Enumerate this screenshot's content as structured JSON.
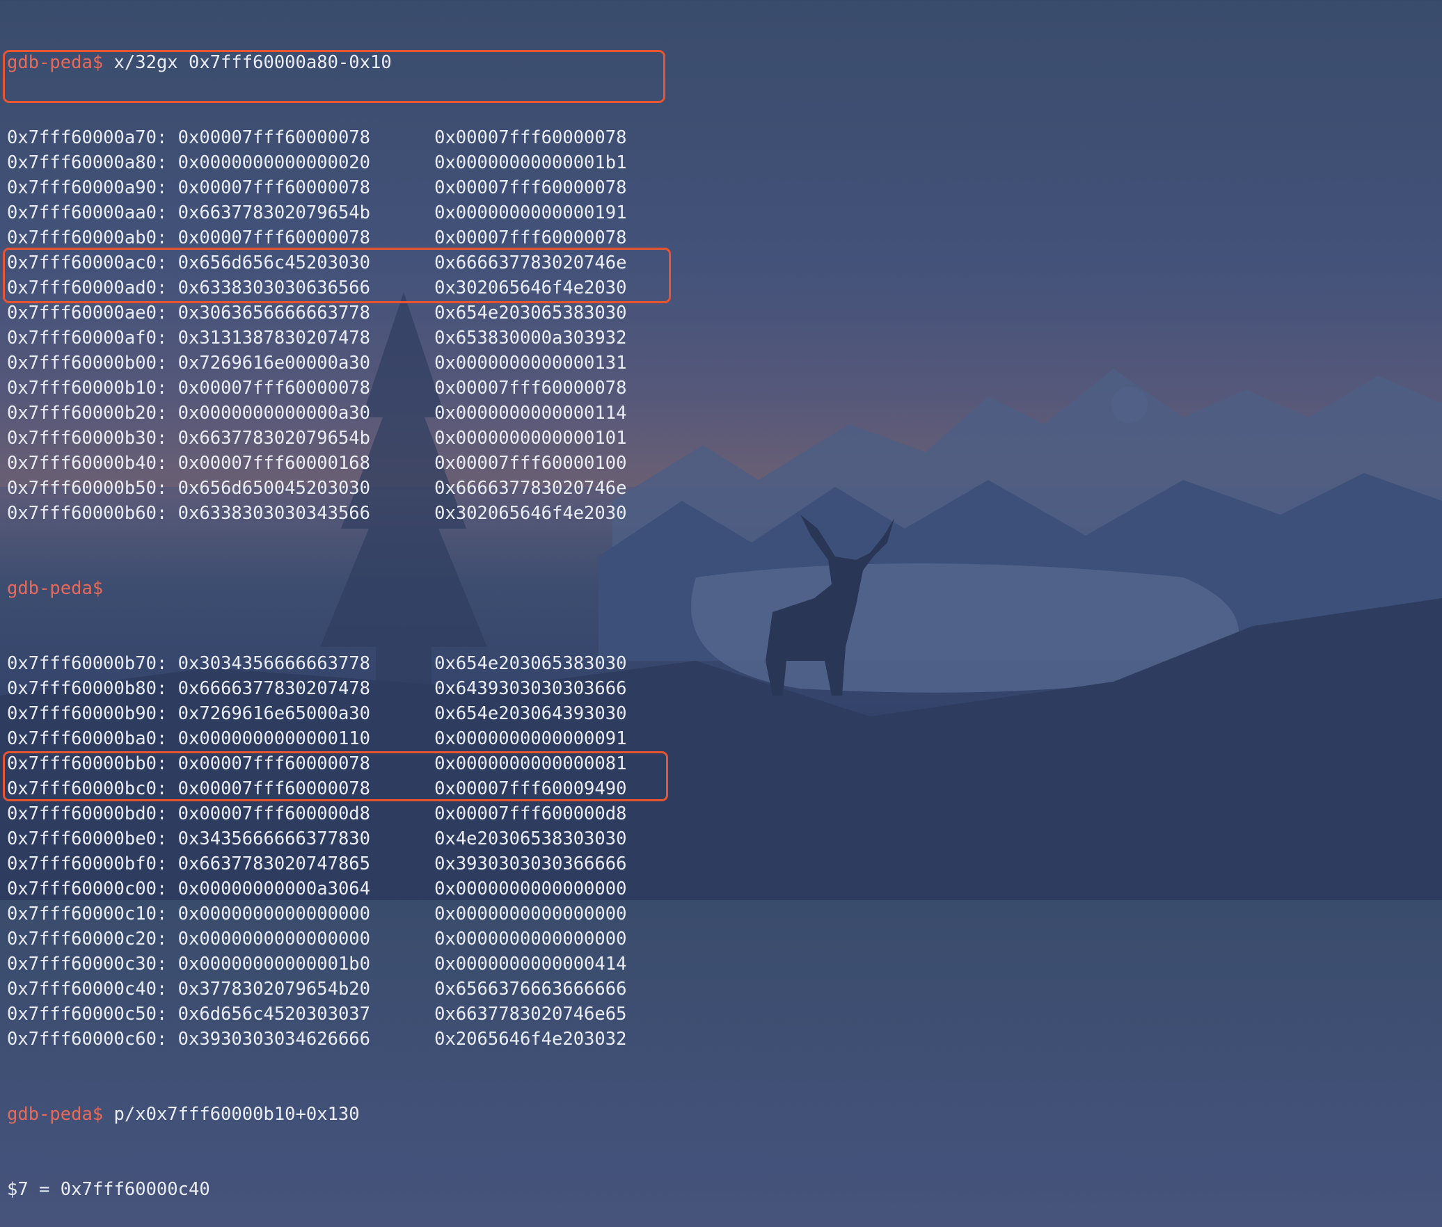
{
  "prompt": "gdb-peda$",
  "command_1": "x/32gx 0x7fff60000a80-0x10",
  "dump_1": [
    {
      "addr": "0x7fff60000a70:",
      "v1": "0x00007fff60000078",
      "v2": "0x00007fff60000078"
    },
    {
      "addr": "0x7fff60000a80:",
      "v1": "0x0000000000000020",
      "v2": "0x00000000000001b1"
    },
    {
      "addr": "0x7fff60000a90:",
      "v1": "0x00007fff60000078",
      "v2": "0x00007fff60000078"
    },
    {
      "addr": "0x7fff60000aa0:",
      "v1": "0x663778302079654b",
      "v2": "0x0000000000000191"
    },
    {
      "addr": "0x7fff60000ab0:",
      "v1": "0x00007fff60000078",
      "v2": "0x00007fff60000078"
    },
    {
      "addr": "0x7fff60000ac0:",
      "v1": "0x656d656c45203030",
      "v2": "0x666637783020746e"
    },
    {
      "addr": "0x7fff60000ad0:",
      "v1": "0x6338303030636566",
      "v2": "0x302065646f4e2030"
    },
    {
      "addr": "0x7fff60000ae0:",
      "v1": "0x3063656666663778",
      "v2": "0x654e203065383030"
    },
    {
      "addr": "0x7fff60000af0:",
      "v1": "0x3131387830207478",
      "v2": "0x653830000a303932"
    },
    {
      "addr": "0x7fff60000b00:",
      "v1": "0x7269616e00000a30",
      "v2": "0x0000000000000131"
    },
    {
      "addr": "0x7fff60000b10:",
      "v1": "0x00007fff60000078",
      "v2": "0x00007fff60000078"
    },
    {
      "addr": "0x7fff60000b20:",
      "v1": "0x0000000000000a30",
      "v2": "0x0000000000000114"
    },
    {
      "addr": "0x7fff60000b30:",
      "v1": "0x663778302079654b",
      "v2": "0x0000000000000101"
    },
    {
      "addr": "0x7fff60000b40:",
      "v1": "0x00007fff60000168",
      "v2": "0x00007fff60000100"
    },
    {
      "addr": "0x7fff60000b50:",
      "v1": "0x656d650045203030",
      "v2": "0x666637783020746e"
    },
    {
      "addr": "0x7fff60000b60:",
      "v1": "0x6338303030343566",
      "v2": "0x302065646f4e2030"
    }
  ],
  "dump_2": [
    {
      "addr": "0x7fff60000b70:",
      "v1": "0x3034356666663778",
      "v2": "0x654e203065383030"
    },
    {
      "addr": "0x7fff60000b80:",
      "v1": "0x6666377830207478",
      "v2": "0x6439303030303666"
    },
    {
      "addr": "0x7fff60000b90:",
      "v1": "0x7269616e65000a30",
      "v2": "0x654e203064393030"
    },
    {
      "addr": "0x7fff60000ba0:",
      "v1": "0x0000000000000110",
      "v2": "0x0000000000000091"
    },
    {
      "addr": "0x7fff60000bb0:",
      "v1": "0x00007fff60000078",
      "v2": "0x0000000000000081"
    },
    {
      "addr": "0x7fff60000bc0:",
      "v1": "0x00007fff60000078",
      "v2": "0x00007fff60009490"
    },
    {
      "addr": "0x7fff60000bd0:",
      "v1": "0x00007fff600000d8",
      "v2": "0x00007fff600000d8"
    },
    {
      "addr": "0x7fff60000be0:",
      "v1": "0x3435666666377830",
      "v2": "0x4e20306538303030"
    },
    {
      "addr": "0x7fff60000bf0:",
      "v1": "0x6637783020747865",
      "v2": "0x3930303030366666"
    },
    {
      "addr": "0x7fff60000c00:",
      "v1": "0x00000000000a3064",
      "v2": "0x0000000000000000"
    },
    {
      "addr": "0x7fff60000c10:",
      "v1": "0x0000000000000000",
      "v2": "0x0000000000000000"
    },
    {
      "addr": "0x7fff60000c20:",
      "v1": "0x0000000000000000",
      "v2": "0x0000000000000000"
    },
    {
      "addr": "0x7fff60000c30:",
      "v1": "0x00000000000001b0",
      "v2": "0x0000000000000414"
    },
    {
      "addr": "0x7fff60000c40:",
      "v1": "0x3778302079654b20",
      "v2": "0x6566376663666666"
    },
    {
      "addr": "0x7fff60000c50:",
      "v1": "0x6d656c4520303037",
      "v2": "0x6637783020746e65"
    },
    {
      "addr": "0x7fff60000c60:",
      "v1": "0x3930303034626666",
      "v2": "0x2065646f4e203032"
    }
  ],
  "command_3": "p/x0x7fff60000b10+0x130",
  "result_3": "$7 = 0x7fff60000c40",
  "colors": {
    "prompt": "#e46a5c",
    "text": "#e9edf3",
    "highlight": "#e8552f"
  }
}
